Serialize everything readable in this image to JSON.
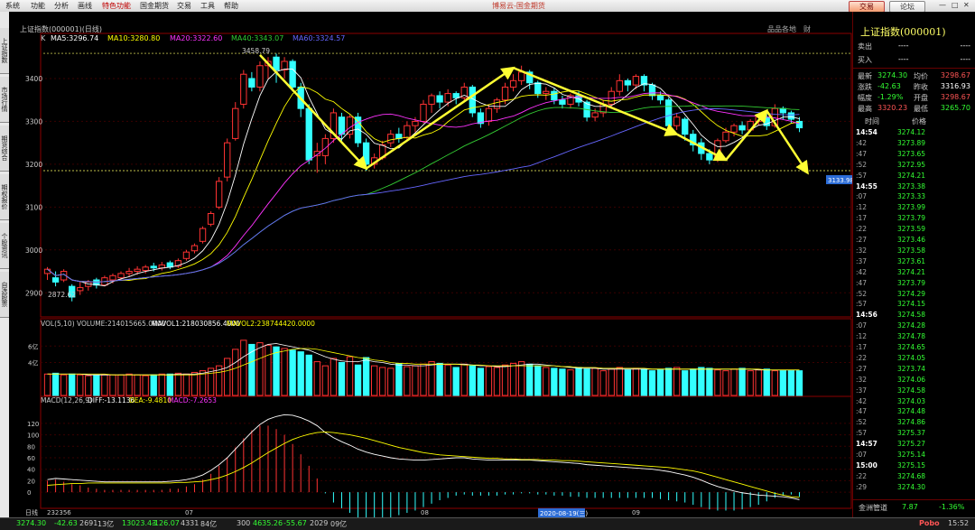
{
  "menu": {
    "items": [
      "系统",
      "功能",
      "分析",
      "画线",
      "特色功能",
      "国金期货",
      "交易",
      "工具",
      "帮助"
    ],
    "app_title": "博易云-国金期货",
    "trade_button": "交易",
    "forum_button": "论坛"
  },
  "left_tabs": [
    "上证指数",
    "市场行情",
    "期货综合",
    "期权报价",
    "个股资讯",
    "自选股票"
  ],
  "chart_header": {
    "k_label": "K",
    "ma5": "MA5:3296.74",
    "ma10": "MA10:3280.80",
    "ma20": "MA20:3322.60",
    "ma40": "MA40:3343.07",
    "ma60": "MA60:3324.57",
    "symbol": "上证指数(000001)(日线)",
    "links": [
      "品品各地",
      "财"
    ]
  },
  "volume_header": {
    "title": "VOL(5,10) VOLUME:214015665.0000",
    "mavol1": "MAVOL1:218030856.4000",
    "mavol2": "MAVOL2:238744420.0000"
  },
  "macd_header": {
    "title": "MACD(12,26,9)",
    "diff": "DIFF:-13.1136",
    "dea": "DEA:-9.4810",
    "macd": "MACD:-7.2653"
  },
  "annotations": {
    "high_label": "3458.79",
    "low_label": "2872.62",
    "price_flag": "3133.98",
    "date_flag": "2020-08-19(三)"
  },
  "x_axis": {
    "start": "232356",
    "labels": [
      "07",
      "08",
      "09"
    ],
    "unit_label": "日线"
  },
  "colors": {
    "up": "#ff3333",
    "down": "#33ffff",
    "ma5": "#ffffff",
    "ma10": "#ffff00",
    "ma20": "#ff33ff",
    "ma40": "#33cc33",
    "ma60": "#6666ff",
    "arrow": "#ffff33",
    "grid": "#8b0000"
  },
  "chart_data": {
    "type": "candlestick",
    "ylim": [
      2850,
      3480
    ],
    "y_ticks": [
      2900,
      3000,
      3100,
      3200,
      3300,
      3400
    ],
    "horizontal_lines": [
      3458.79,
      3185
    ],
    "candles": [
      [
        2945,
        2955,
        2930,
        2960
      ],
      [
        2935,
        2925,
        2915,
        2950
      ],
      [
        2930,
        2950,
        2925,
        2955
      ],
      [
        2915,
        2890,
        2880,
        2920
      ],
      [
        2905,
        2912,
        2895,
        2925
      ],
      [
        2915,
        2925,
        2905,
        2930
      ],
      [
        2930,
        2918,
        2910,
        2935
      ],
      [
        2918,
        2935,
        2915,
        2940
      ],
      [
        2930,
        2940,
        2922,
        2945
      ],
      [
        2935,
        2945,
        2928,
        2950
      ],
      [
        2945,
        2950,
        2938,
        2958
      ],
      [
        2950,
        2955,
        2942,
        2962
      ],
      [
        2952,
        2960,
        2945,
        2965
      ],
      [
        2962,
        2958,
        2950,
        2970
      ],
      [
        2958,
        2965,
        2952,
        2972
      ],
      [
        2970,
        2960,
        2955,
        2975
      ],
      [
        2962,
        2975,
        2958,
        2980
      ],
      [
        2980,
        2995,
        2975,
        3000
      ],
      [
        2998,
        3010,
        2992,
        3015
      ],
      [
        3020,
        3050,
        3015,
        3055
      ],
      [
        3060,
        3085,
        3055,
        3090
      ],
      [
        3100,
        3160,
        3095,
        3170
      ],
      [
        3170,
        3250,
        3160,
        3260
      ],
      [
        3260,
        3330,
        3255,
        3345
      ],
      [
        3340,
        3410,
        3330,
        3420
      ],
      [
        3400,
        3380,
        3370,
        3415
      ],
      [
        3380,
        3430,
        3370,
        3440
      ],
      [
        3430,
        3440,
        3400,
        3450
      ],
      [
        3450,
        3420,
        3390,
        3458
      ],
      [
        3420,
        3440,
        3400,
        3450
      ],
      [
        3440,
        3380,
        3370,
        3445
      ],
      [
        3380,
        3330,
        3310,
        3390
      ],
      [
        3330,
        3210,
        3200,
        3340
      ],
      [
        3220,
        3230,
        3180,
        3250
      ],
      [
        3220,
        3260,
        3200,
        3270
      ],
      [
        3260,
        3320,
        3250,
        3330
      ],
      [
        3310,
        3270,
        3250,
        3320
      ],
      [
        3270,
        3310,
        3260,
        3315
      ],
      [
        3310,
        3250,
        3240,
        3320
      ],
      [
        3250,
        3200,
        3185,
        3260
      ],
      [
        3200,
        3215,
        3190,
        3225
      ],
      [
        3215,
        3245,
        3210,
        3255
      ],
      [
        3250,
        3270,
        3240,
        3280
      ],
      [
        3270,
        3260,
        3250,
        3285
      ],
      [
        3262,
        3290,
        3255,
        3300
      ],
      [
        3290,
        3300,
        3275,
        3310
      ],
      [
        3300,
        3340,
        3295,
        3350
      ],
      [
        3340,
        3360,
        3320,
        3365
      ],
      [
        3360,
        3345,
        3330,
        3370
      ],
      [
        3345,
        3365,
        3335,
        3375
      ],
      [
        3365,
        3355,
        3340,
        3370
      ],
      [
        3355,
        3380,
        3345,
        3390
      ],
      [
        3380,
        3320,
        3310,
        3385
      ],
      [
        3320,
        3295,
        3285,
        3330
      ],
      [
        3300,
        3330,
        3290,
        3340
      ],
      [
        3330,
        3350,
        3320,
        3355
      ],
      [
        3350,
        3380,
        3340,
        3390
      ],
      [
        3380,
        3395,
        3370,
        3410
      ],
      [
        3395,
        3415,
        3385,
        3430
      ],
      [
        3415,
        3390,
        3375,
        3420
      ],
      [
        3390,
        3365,
        3355,
        3395
      ],
      [
        3365,
        3370,
        3350,
        3380
      ],
      [
        3370,
        3350,
        3340,
        3378
      ],
      [
        3350,
        3340,
        3330,
        3360
      ],
      [
        3340,
        3360,
        3330,
        3365
      ],
      [
        3360,
        3345,
        3335,
        3370
      ],
      [
        3345,
        3310,
        3300,
        3350
      ],
      [
        3310,
        3320,
        3300,
        3330
      ],
      [
        3320,
        3340,
        3310,
        3350
      ],
      [
        3340,
        3370,
        3330,
        3380
      ],
      [
        3370,
        3395,
        3360,
        3410
      ],
      [
        3395,
        3385,
        3370,
        3400
      ],
      [
        3385,
        3405,
        3375,
        3410
      ],
      [
        3405,
        3385,
        3370,
        3410
      ],
      [
        3385,
        3360,
        3350,
        3390
      ],
      [
        3360,
        3350,
        3340,
        3370
      ],
      [
        3350,
        3290,
        3280,
        3355
      ],
      [
        3290,
        3310,
        3280,
        3320
      ],
      [
        3305,
        3270,
        3255,
        3310
      ],
      [
        3270,
        3245,
        3230,
        3280
      ],
      [
        3250,
        3225,
        3210,
        3260
      ],
      [
        3225,
        3210,
        3200,
        3235
      ],
      [
        3210,
        3255,
        3205,
        3260
      ],
      [
        3255,
        3275,
        3250,
        3285
      ],
      [
        3275,
        3290,
        3265,
        3295
      ],
      [
        3290,
        3280,
        3270,
        3300
      ],
      [
        3280,
        3300,
        3275,
        3305
      ],
      [
        3300,
        3310,
        3290,
        3315
      ],
      [
        3310,
        3290,
        3280,
        3320
      ],
      [
        3290,
        3330,
        3285,
        3340
      ],
      [
        3330,
        3320,
        3305,
        3335
      ],
      [
        3320,
        3305,
        3295,
        3325
      ],
      [
        3300,
        3285,
        3275,
        3310
      ]
    ],
    "arrows": [
      [
        26,
        3455,
        39,
        3190
      ],
      [
        39,
        3190,
        57,
        3425
      ],
      [
        57,
        3425,
        77,
        3270
      ],
      [
        77,
        3270,
        83,
        3210
      ],
      [
        83,
        3210,
        88,
        3325
      ],
      [
        88,
        3325,
        93,
        3180
      ]
    ],
    "volume": {
      "ylim": [
        0,
        8
      ],
      "ticks": [
        4,
        6
      ],
      "tick_labels": [
        "4亿",
        "6亿"
      ],
      "values": [
        2.6,
        2.7,
        2.5,
        2.6,
        2.5,
        2.4,
        2.4,
        2.5,
        2.5,
        2.5,
        2.6,
        2.5,
        2.4,
        2.5,
        2.6,
        2.6,
        2.7,
        2.6,
        2.8,
        3.0,
        3.3,
        3.6,
        4.5,
        5.6,
        6.7,
        6.2,
        6.4,
        6.1,
        5.9,
        5.7,
        5.5,
        5.3,
        4.9,
        4.1,
        3.6,
        4.5,
        4.0,
        4.7,
        3.7,
        4.6,
        3.6,
        3.4,
        3.3,
        3.9,
        3.5,
        3.6,
        3.8,
        4.1,
        3.9,
        3.7,
        3.4,
        3.8,
        3.6,
        3.3,
        3.5,
        3.4,
        3.7,
        3.9,
        4.1,
        3.8,
        3.6,
        3.4,
        3.3,
        3.2,
        3.1,
        3.4,
        3.2,
        3.3,
        3.0,
        3.2,
        3.4,
        3.1,
        3.3,
        3.2,
        3.0,
        3.1,
        3.3,
        3.4,
        3.0,
        3.2,
        3.4,
        3.3,
        3.1,
        3.0,
        3.2,
        3.3,
        3.0,
        3.1,
        3.2,
        3.0,
        3.0,
        3.0,
        3.0
      ],
      "mavol1": [
        2.6,
        2.6,
        2.6,
        2.6,
        2.6,
        2.5,
        2.5,
        2.5,
        2.5,
        2.5,
        2.5,
        2.5,
        2.5,
        2.5,
        2.5,
        2.5,
        2.6,
        2.6,
        2.6,
        2.7,
        2.9,
        3.1,
        3.4,
        4.0,
        4.7,
        5.3,
        5.8,
        6.2,
        6.3,
        6.1,
        5.9,
        5.7,
        5.5,
        5.1,
        4.7,
        4.4,
        4.2,
        4.1,
        4.1,
        4.3,
        4.1,
        4.0,
        3.8,
        3.7,
        3.7,
        3.6,
        3.6,
        3.7,
        3.8,
        3.8,
        3.8,
        3.8,
        3.7,
        3.6,
        3.6,
        3.5,
        3.5,
        3.6,
        3.7,
        3.8,
        3.8,
        3.7,
        3.6,
        3.5,
        3.4,
        3.3,
        3.3,
        3.3,
        3.2,
        3.2,
        3.2,
        3.2,
        3.2,
        3.2,
        3.2,
        3.2,
        3.2,
        3.2,
        3.2,
        3.2,
        3.2,
        3.2,
        3.2,
        3.2,
        3.2,
        3.2,
        3.2,
        3.1,
        3.1,
        3.1,
        3.1,
        3.1,
        3.1
      ],
      "mavol2": [
        2.6,
        2.6,
        2.6,
        2.6,
        2.6,
        2.6,
        2.6,
        2.6,
        2.5,
        2.5,
        2.5,
        2.5,
        2.5,
        2.5,
        2.5,
        2.5,
        2.5,
        2.5,
        2.5,
        2.6,
        2.7,
        2.8,
        3.0,
        3.3,
        3.7,
        4.1,
        4.5,
        4.9,
        5.2,
        5.4,
        5.6,
        5.7,
        5.7,
        5.6,
        5.4,
        5.2,
        5.0,
        4.8,
        4.6,
        4.5,
        4.3,
        4.2,
        4.0,
        3.9,
        3.9,
        3.8,
        3.8,
        3.8,
        3.8,
        3.8,
        3.8,
        3.7,
        3.7,
        3.7,
        3.6,
        3.6,
        3.6,
        3.6,
        3.6,
        3.6,
        3.6,
        3.6,
        3.6,
        3.5,
        3.5,
        3.4,
        3.4,
        3.4,
        3.3,
        3.3,
        3.3,
        3.3,
        3.3,
        3.3,
        3.2,
        3.2,
        3.2,
        3.2,
        3.2,
        3.2,
        3.2,
        3.2,
        3.2,
        3.2,
        3.2,
        3.2,
        3.2,
        3.2,
        3.1,
        3.1,
        3.1,
        3.1,
        3.1
      ]
    },
    "macd": {
      "ylim": [
        -25,
        145
      ],
      "ticks": [
        0,
        20,
        40,
        60,
        80,
        100,
        120
      ],
      "diff": [
        22,
        24,
        23,
        22,
        21,
        20,
        19,
        18,
        18,
        18,
        18,
        18,
        18,
        18,
        18,
        19,
        20,
        22,
        25,
        30,
        38,
        48,
        60,
        75,
        90,
        105,
        118,
        127,
        132,
        135,
        134,
        130,
        124,
        116,
        104,
        95,
        88,
        82,
        75,
        70,
        66,
        63,
        60,
        58,
        57,
        56,
        56,
        57,
        58,
        59,
        60,
        60,
        58,
        57,
        56,
        56,
        56,
        56,
        56,
        56,
        55,
        54,
        53,
        52,
        51,
        50,
        48,
        47,
        46,
        45,
        44,
        43,
        42,
        41,
        40,
        38,
        36,
        33,
        30,
        26,
        21,
        15,
        10,
        6,
        2,
        -1,
        -3,
        -5,
        -6,
        -7,
        -8,
        -10,
        -13
      ],
      "dea": [
        12,
        13,
        14,
        15,
        15,
        16,
        16,
        16,
        16,
        16,
        16,
        16,
        16,
        16,
        16,
        16,
        17,
        17,
        18,
        19,
        22,
        25,
        30,
        36,
        43,
        51,
        60,
        69,
        77,
        85,
        92,
        97,
        101,
        104,
        105,
        104,
        102,
        100,
        97,
        94,
        90,
        86,
        82,
        78,
        75,
        72,
        69,
        67,
        65,
        64,
        63,
        62,
        61,
        60,
        59,
        59,
        58,
        58,
        57,
        57,
        57,
        56,
        56,
        55,
        55,
        54,
        53,
        52,
        51,
        50,
        49,
        48,
        47,
        46,
        45,
        44,
        43,
        41,
        39,
        37,
        34,
        30,
        26,
        22,
        18,
        14,
        10,
        6,
        2,
        -2,
        -5,
        -8,
        -9
      ]
    }
  },
  "panel": {
    "title": "上证指数(000001)",
    "sell_label": "卖出",
    "buy_label": "买入",
    "empty_value": "----",
    "stats": [
      [
        "最新",
        "3274.30",
        "均价",
        "3298.67"
      ],
      [
        "涨跌",
        "-42.63",
        "昨收",
        "3316.93"
      ],
      [
        "幅度",
        "-1.29%",
        "开盘",
        "3298.67"
      ],
      [
        "最高",
        "3320.23",
        "最低",
        "3265.70"
      ]
    ],
    "col_time": "时间",
    "col_price": "价格",
    "ticks": [
      [
        "14:54",
        "3274.12"
      ],
      [
        ":42",
        "3273.89"
      ],
      [
        ":47",
        "3273.65"
      ],
      [
        ":52",
        "3272.95"
      ],
      [
        ":57",
        "3274.21"
      ],
      [
        "14:55",
        "3273.38"
      ],
      [
        ":07",
        "3273.33"
      ],
      [
        ":12",
        "3273.99"
      ],
      [
        ":17",
        "3273.79"
      ],
      [
        ":22",
        "3273.59"
      ],
      [
        ":27",
        "3273.46"
      ],
      [
        ":32",
        "3273.58"
      ],
      [
        ":37",
        "3273.61"
      ],
      [
        ":42",
        "3274.21"
      ],
      [
        ":47",
        "3273.79"
      ],
      [
        ":52",
        "3274.29"
      ],
      [
        ":57",
        "3274.15"
      ],
      [
        "14:56",
        "3274.58"
      ],
      [
        ":07",
        "3274.28"
      ],
      [
        ":12",
        "3274.78"
      ],
      [
        ":17",
        "3274.65"
      ],
      [
        ":22",
        "3274.05"
      ],
      [
        ":27",
        "3273.74"
      ],
      [
        ":32",
        "3274.06"
      ],
      [
        ":37",
        "3274.58"
      ],
      [
        ":42",
        "3274.03"
      ],
      [
        ":47",
        "3274.48"
      ],
      [
        ":52",
        "3274.86"
      ],
      [
        ":57",
        "3275.37"
      ],
      [
        "14:57",
        "3275.27"
      ],
      [
        ":07",
        "3275.14"
      ],
      [
        "15:00",
        "3275.15"
      ],
      [
        ":22",
        "3274.68"
      ],
      [
        ":29",
        "3274.30"
      ]
    ],
    "bottom_label": "金洲管道",
    "bottom_value": "7.87",
    "bottom_pct": "-1.36%"
  },
  "statusbar": {
    "items": [
      "3274.30",
      "-42.63",
      "2691",
      "13亿",
      "13023.43",
      "-126.07",
      "4331",
      "84亿",
      "300",
      "4635.26",
      "-55.67",
      "2029",
      "09亿"
    ],
    "brand": "Pobo",
    "time": "15:52"
  }
}
